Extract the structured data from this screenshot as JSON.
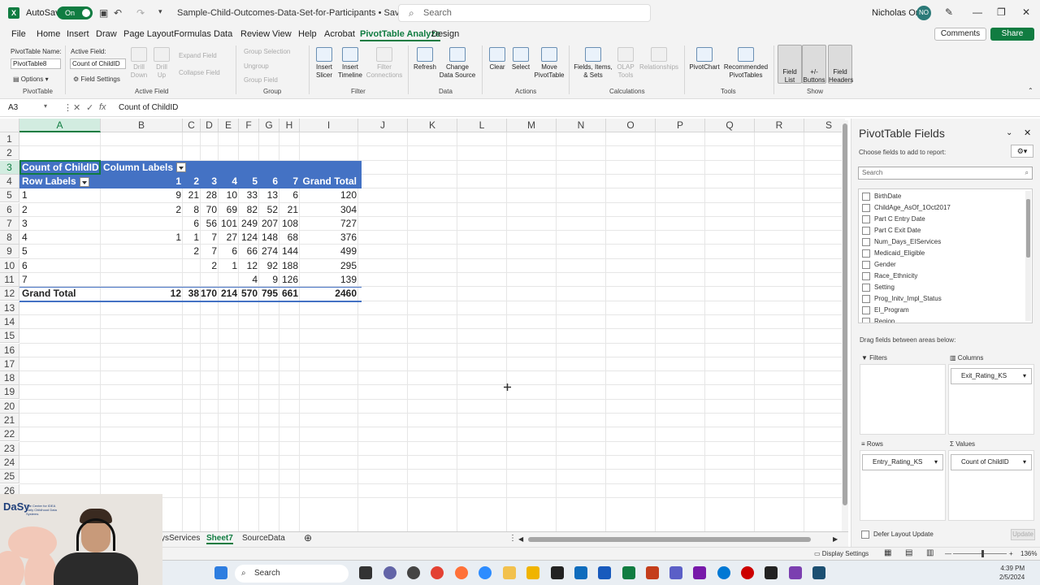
{
  "titlebar": {
    "autosave_label": "AutoSave",
    "autosave_state": "On",
    "filename": "Sample-Child-Outcomes-Data-Set-for-Participants • Saved",
    "search_placeholder": "Search",
    "user_name": "Nicholas Ortiz",
    "user_initials": "NO"
  },
  "menu": {
    "items": [
      "File",
      "Home",
      "Insert",
      "Draw",
      "Page Layout",
      "Formulas",
      "Data",
      "Review",
      "View",
      "Help",
      "Acrobat",
      "PivotTable Analyze",
      "Design"
    ],
    "active": "PivotTable Analyze",
    "comments": "Comments",
    "share": "Share"
  },
  "ribbon": {
    "pivottable_name_label": "PivotTable Name:",
    "pivottable_name": "PivotTable8",
    "options": "Options",
    "group_pivottable": "PivotTable",
    "active_field_label": "Active Field:",
    "active_field": "Count of ChildID",
    "field_settings": "Field Settings",
    "drill_down": "Drill Down",
    "drill_up": "Drill Up",
    "expand_field": "Expand Field",
    "collapse_field": "Collapse Field",
    "group_active_field": "Active Field",
    "group_selection": "Group Selection",
    "ungroup": "Ungroup",
    "group_field": "Group Field",
    "group_group": "Group",
    "insert_slicer": "Insert Slicer",
    "insert_timeline": "Insert Timeline",
    "filter_connections": "Filter Connections",
    "group_filter": "Filter",
    "refresh": "Refresh",
    "change_data_source": "Change Data Source",
    "group_data": "Data",
    "clear": "Clear",
    "select": "Select",
    "move_pivottable": "Move PivotTable",
    "group_actions": "Actions",
    "fields_items_sets": "Fields, Items, & Sets",
    "olap_tools": "OLAP Tools",
    "relationships": "Relationships",
    "group_calculations": "Calculations",
    "pivotchart": "PivotChart",
    "recommended_pivottables": "Recommended PivotTables",
    "group_tools": "Tools",
    "field_list": "Field List",
    "buttons": "+/- Buttons",
    "field_headers": "Field Headers",
    "group_show": "Show"
  },
  "formula_bar": {
    "name_box": "A3",
    "fx": "fx",
    "value": "Count of ChildID"
  },
  "grid": {
    "columns": [
      "A",
      "B",
      "C",
      "D",
      "E",
      "F",
      "G",
      "H",
      "I",
      "J",
      "K",
      "L",
      "M",
      "N",
      "O",
      "P",
      "Q",
      "R",
      "S"
    ],
    "rows": [
      "1",
      "2",
      "3",
      "4",
      "5",
      "6",
      "7",
      "8",
      "9",
      "10",
      "11",
      "12",
      "13",
      "14",
      "15",
      "16",
      "17",
      "18",
      "19",
      "20",
      "21",
      "22",
      "23",
      "24",
      "25",
      "26"
    ]
  },
  "pivot": {
    "corner_label": "Count of ChildID",
    "column_labels": "Column Labels",
    "row_labels": "Row Labels",
    "col_keys": [
      "1",
      "2",
      "3",
      "4",
      "5",
      "6",
      "7"
    ],
    "grand_total_label": "Grand Total",
    "rows": [
      {
        "label": "1",
        "values": [
          "9",
          "21",
          "28",
          "10",
          "33",
          "13",
          "6"
        ],
        "total": "120"
      },
      {
        "label": "2",
        "values": [
          "2",
          "8",
          "70",
          "69",
          "82",
          "52",
          "21"
        ],
        "total": "304"
      },
      {
        "label": "3",
        "values": [
          "",
          "6",
          "56",
          "101",
          "249",
          "207",
          "108"
        ],
        "total": "727"
      },
      {
        "label": "4",
        "values": [
          "1",
          "1",
          "7",
          "27",
          "124",
          "148",
          "68"
        ],
        "total": "376"
      },
      {
        "label": "5",
        "values": [
          "",
          "2",
          "7",
          "6",
          "66",
          "274",
          "144"
        ],
        "total": "499"
      },
      {
        "label": "6",
        "values": [
          "",
          "",
          "2",
          "1",
          "12",
          "92",
          "188"
        ],
        "total": "295"
      },
      {
        "label": "7",
        "values": [
          "",
          "",
          "",
          "",
          "4",
          "9",
          "126"
        ],
        "total": "139"
      }
    ],
    "grand_total_row": {
      "values": [
        "12",
        "38",
        "170",
        "214",
        "570",
        "795",
        "661"
      ],
      "total": "2460"
    }
  },
  "sheet_tabs": [
    "ysServices",
    "Sheet7",
    "SourceData"
  ],
  "active_sheet": "Sheet7",
  "panel": {
    "title": "PivotTable Fields",
    "subtitle": "Choose fields to add to report:",
    "search_placeholder": "Search",
    "fields": [
      "BirthDate",
      "ChildAge_AsOf_1Oct2017",
      "Part C Entry Date",
      "Part C Exit Date",
      "Num_Days_EIServices",
      "Medicaid_Eligible",
      "Gender",
      "Race_Ethnicity",
      "Setting",
      "Prog_Initv_Impl_Status",
      "EI_Program",
      "Region"
    ],
    "drag_label": "Drag fields between areas below:",
    "filters": "Filters",
    "columns": "Columns",
    "rows": "Rows",
    "values": "Values",
    "columns_field": "Exit_Rating_KS",
    "rows_field": "Entry_Rating_KS",
    "values_field": "Count of ChildID",
    "defer": "Defer Layout Update",
    "update": "Update"
  },
  "status": {
    "display_settings": "Display Settings",
    "zoom": "136%"
  },
  "taskbar": {
    "search": "Search",
    "time": "4:39 PM",
    "date": "2/5/2024"
  },
  "webcam": {
    "logo": "DaSy",
    "logo_sub": "The Center for IDEA Early Childhood Data Systems"
  }
}
